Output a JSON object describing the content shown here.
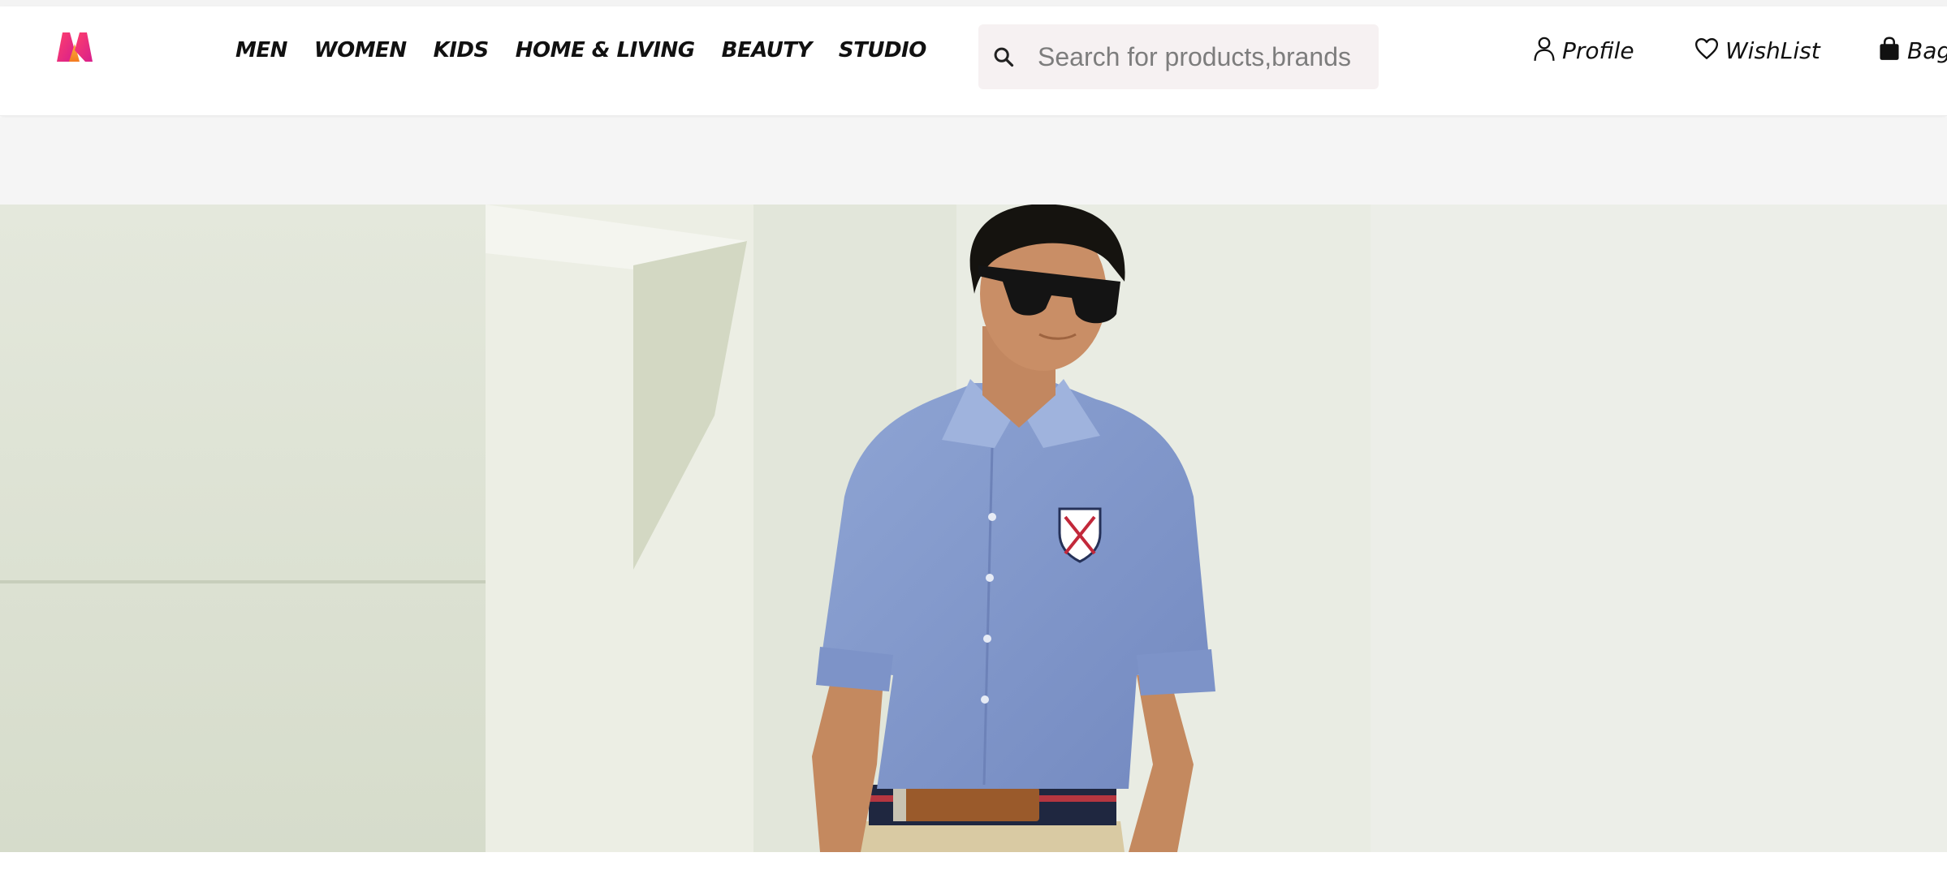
{
  "header": {
    "logo_icon": "myntra-logo-icon",
    "nav": [
      {
        "label": "MEN"
      },
      {
        "label": "WOMEN"
      },
      {
        "label": "KIDS"
      },
      {
        "label": "HOME & LIVING"
      },
      {
        "label": "BEAUTY"
      },
      {
        "label": "STUDIO"
      }
    ],
    "search": {
      "placeholder": "Search for products,brands",
      "value": "",
      "icon": "search-icon"
    },
    "actions": {
      "profile": {
        "label": "Profile",
        "icon": "user-icon"
      },
      "wishlist": {
        "label": "WishList",
        "icon": "heart-icon"
      },
      "bag": {
        "label": "Bag",
        "icon": "shopping-bag-icon"
      }
    }
  },
  "hero": {
    "image_icon": "man-in-blue-shirt-photo"
  },
  "colors": {
    "logo_pink": "#ff3f6c",
    "logo_orange": "#f98c2b",
    "logo_purple": "#d71f8c",
    "search_bg": "#f6f1f2",
    "band_gray": "#f5f5f5"
  }
}
